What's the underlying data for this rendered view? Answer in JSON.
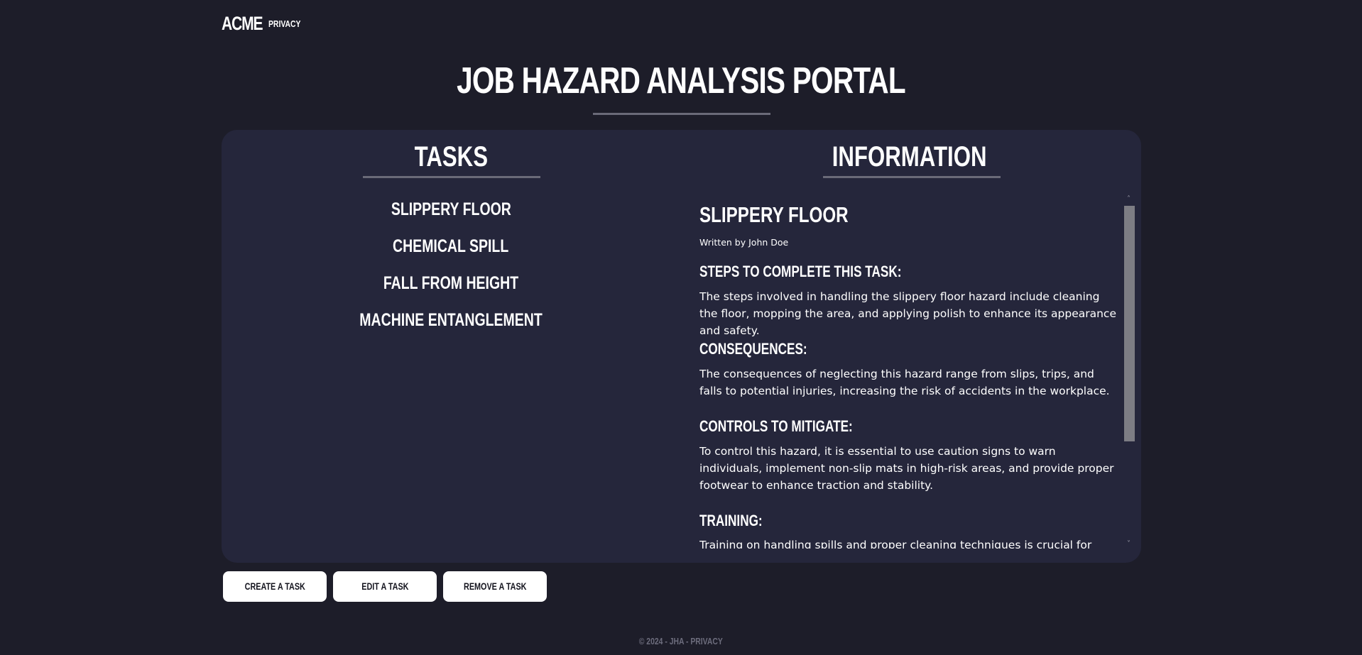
{
  "nav": {
    "brand": "ACME",
    "privacy_link": "PRIVACY"
  },
  "page": {
    "title": "JOB HAZARD ANALYSIS PORTAL"
  },
  "tasks": {
    "heading": "TASKS",
    "items": [
      {
        "label": "SLIPPERY FLOOR"
      },
      {
        "label": "CHEMICAL SPILL"
      },
      {
        "label": "FALL FROM HEIGHT"
      },
      {
        "label": "MACHINE ENTANGLEMENT"
      }
    ]
  },
  "information": {
    "heading": "INFORMATION",
    "title": "SLIPPERY FLOOR",
    "author": "Written by John Doe",
    "sections": [
      {
        "heading": "STEPS TO COMPLETE THIS TASK:",
        "text": "The steps involved in handling the slippery floor hazard include cleaning the floor, mopping the area, and applying polish to enhance its appearance and safety."
      },
      {
        "heading": "CONSEQUENCES:",
        "text": "The consequences of neglecting this hazard range from slips, trips, and falls to potential injuries, increasing the risk of accidents in the workplace."
      },
      {
        "heading": "CONTROLS TO MITIGATE:",
        "text": "To control this hazard, it is essential to use caution signs to warn individuals, implement non-slip mats in high-risk areas, and provide proper footwear to enhance traction and stability."
      },
      {
        "heading": "TRAINING:",
        "text": "Training on handling spills and proper cleaning techniques is crucial for"
      }
    ]
  },
  "actions": {
    "create": "CREATE A TASK",
    "edit": "EDIT A TASK",
    "remove": "REMOVE A TASK"
  },
  "footer": {
    "text": "© 2024 - JHA - PRIVACY"
  },
  "icons": {
    "scroll_up": "chevron-up-icon",
    "scroll_down": "chevron-down-icon"
  },
  "colors": {
    "background": "#1d1d29",
    "panel": "#25263b",
    "accent_line": "#6a6a78",
    "button_bg": "#ffffff"
  }
}
